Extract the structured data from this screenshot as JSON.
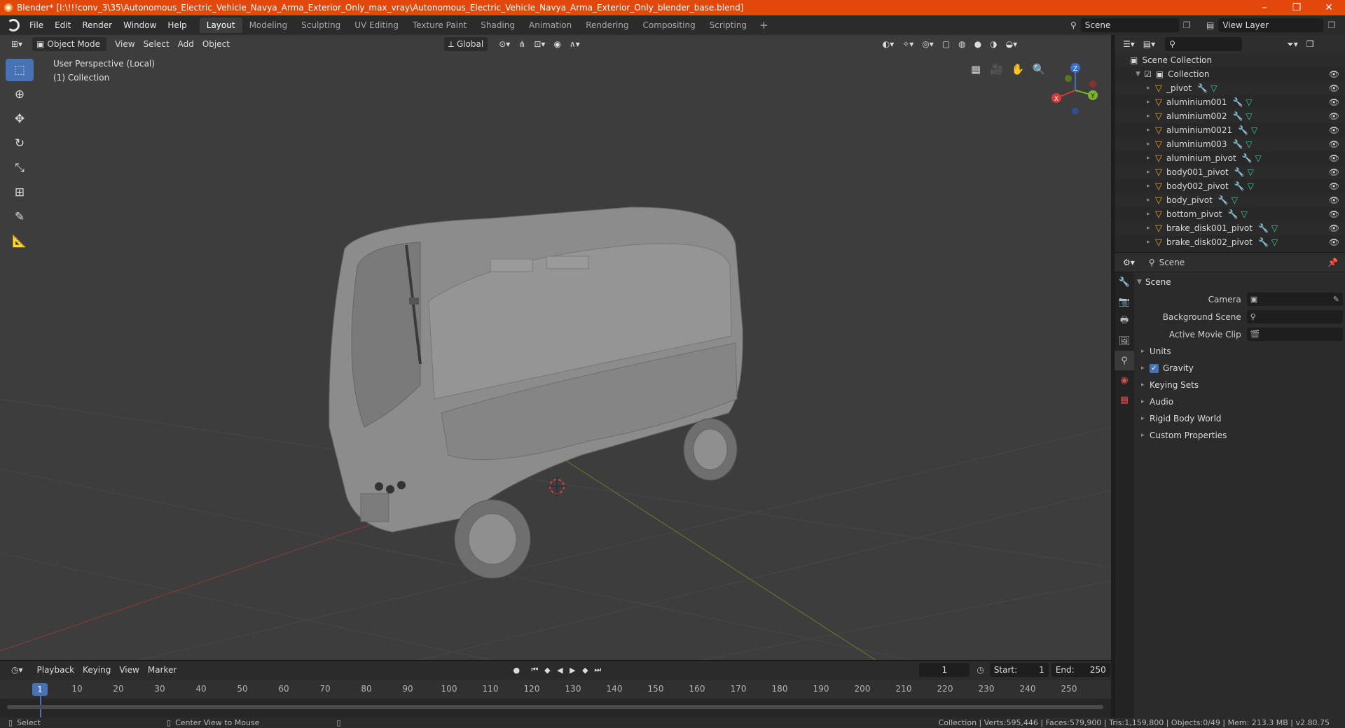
{
  "window": {
    "title": "Blender* [I:\\!!!conv_3\\35\\Autonomous_Electric_Vehicle_Navya_Arma_Exterior_Only_max_vray\\Autonomous_Electric_Vehicle_Navya_Arma_Exterior_Only_blender_base.blend]",
    "minimize": "–",
    "restore": "❐",
    "close": "✕"
  },
  "menu": {
    "items": [
      "File",
      "Edit",
      "Render",
      "Window",
      "Help"
    ],
    "workspaces": [
      "Layout",
      "Modeling",
      "Sculpting",
      "UV Editing",
      "Texture Paint",
      "Shading",
      "Animation",
      "Rendering",
      "Compositing",
      "Scripting"
    ],
    "active_workspace": "Layout",
    "add_workspace": "+",
    "scene": "Scene",
    "view_layer": "View Layer"
  },
  "viewport": {
    "mode": "Object Mode",
    "menus": [
      "View",
      "Select",
      "Add",
      "Object"
    ],
    "transform_orientation": "Global",
    "perspective_label": "User Perspective (Local)",
    "collection_label": "(1) Collection",
    "gizmo": {
      "z": "Z",
      "y": "Y",
      "x": "X"
    }
  },
  "tools": [
    "select-box",
    "cursor",
    "move",
    "rotate",
    "scale",
    "transform",
    "annotate",
    "measure"
  ],
  "timeline": {
    "menus": [
      "Playback",
      "Keying",
      "View",
      "Marker"
    ],
    "current_frame": "1",
    "start_label": "Start:",
    "start": "1",
    "end_label": "End:",
    "end": "250",
    "ruler": [
      "10",
      "20",
      "30",
      "40",
      "50",
      "60",
      "70",
      "80",
      "90",
      "100",
      "110",
      "120",
      "130",
      "140",
      "150",
      "160",
      "170",
      "180",
      "190",
      "200",
      "210",
      "220",
      "230",
      "240",
      "250"
    ],
    "ruler_current": "1"
  },
  "statusbar": {
    "left": "Select",
    "middle": "Center View to Mouse",
    "right": "Collection | Verts:595,446 | Faces:579,900 | Tris:1,159,800 | Objects:0/49 | Mem: 213.3 MB | v2.80.75"
  },
  "outliner": {
    "scene_collection": "Scene Collection",
    "collection": "Collection",
    "objects": [
      "_pivot",
      "aluminium001",
      "aluminium002",
      "aluminium0021",
      "aluminium003",
      "aluminium_pivot",
      "body001_pivot",
      "body002_pivot",
      "body_pivot",
      "bottom_pivot",
      "brake_disk001_pivot",
      "brake_disk002_pivot"
    ]
  },
  "properties": {
    "header": "Scene",
    "panel": "Scene",
    "camera_label": "Camera",
    "background_scene_label": "Background Scene",
    "active_movie_clip_label": "Active Movie Clip",
    "subpanels": [
      "Units",
      "Gravity",
      "Keying Sets",
      "Audio",
      "Rigid Body World",
      "Custom Properties"
    ],
    "gravity_checked": true
  }
}
